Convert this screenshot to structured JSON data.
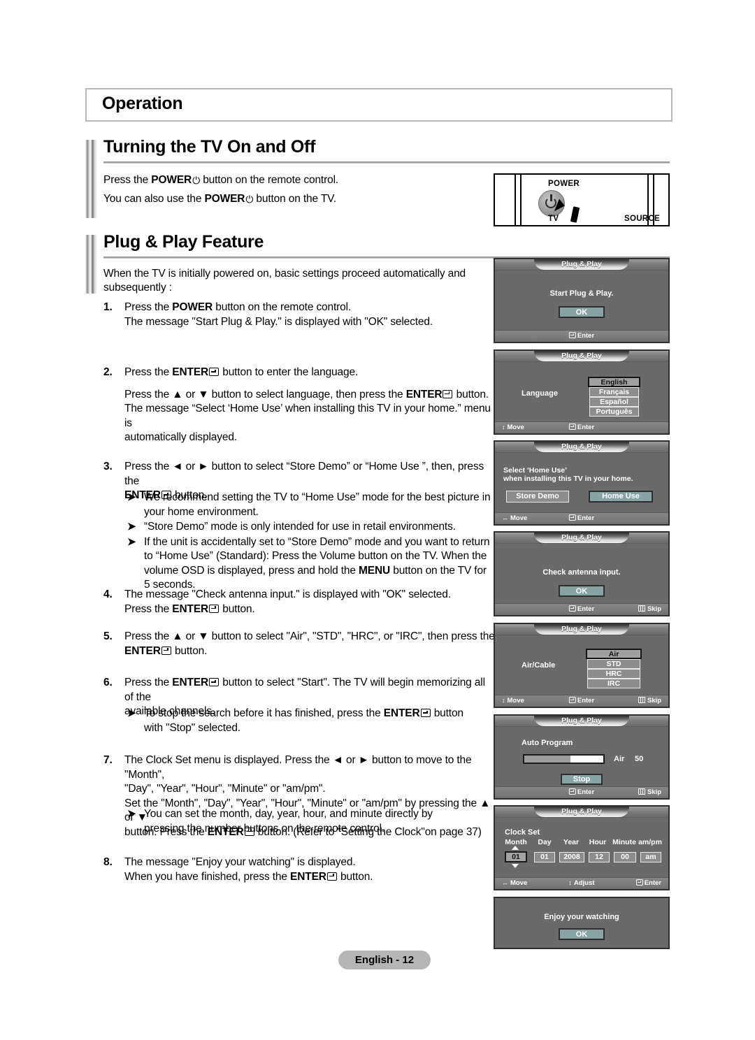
{
  "chapter": {
    "title": "Operation"
  },
  "sections": [
    {
      "heading": "Turning the TV On and Off"
    },
    {
      "heading": "Plug & Play Feature"
    }
  ],
  "turning_on": {
    "line1_pre": "Press the ",
    "line1_bold": "POWER",
    "line1_post": " button on the remote control.",
    "line2_pre": "You can also use the ",
    "line2_bold": "POWER",
    "line2_post": " button on the TV."
  },
  "tv_panel": {
    "power_label": "POWER",
    "tv_label": "TV",
    "source_label": "SOURCE"
  },
  "plug_intro": "When the TV is initially powered on, basic settings proceed automatically and subsequently :",
  "steps": [
    {
      "num": "1.",
      "lines": [
        "Press the POWER button on the remote control.",
        "The message \"Start Plug & Play.\" is displayed with \"OK\" selected."
      ]
    },
    {
      "num": "2.",
      "lines": [
        "Press the ENTER button to enter the language.",
        "Press the ▲ or ▼ button to select language, then press the ENTER button.",
        "The message “Select ‘Home Use’ when installing this TV in your home.” menu is",
        "automatically displayed."
      ]
    },
    {
      "num": "3.",
      "lines": [
        "Press the ◄ or ► button to select “Store Demo” or “Home Use ”, then, press the",
        "ENTER button."
      ],
      "bullets": [
        "We recommend setting the TV to “Home Use” mode for the best picture in your home environment.",
        "“Store Demo” mode is only intended for use in retail environments.",
        "If the unit is accidentally set to “Store Demo” mode and you want to return to “Home Use” (Standard): Press the Volume button on the TV. When the volume OSD is displayed, press and hold the MENU button on the TV for 5 seconds."
      ]
    },
    {
      "num": "4.",
      "lines": [
        "The message \"Check antenna input.\" is displayed with \"OK\" selected.",
        "Press the ENTER button."
      ]
    },
    {
      "num": "5.",
      "lines": [
        "Press the ▲ or ▼ button to select \"Air\", \"STD\", \"HRC\", or \"IRC\", then press the",
        "ENTER button."
      ]
    },
    {
      "num": "6.",
      "lines": [
        "Press the ENTER button to select \"Start\". The TV will begin memorizing all of the",
        "available channels."
      ],
      "bullets": [
        "To stop the search before it has finished, press the ENTER button with \"Stop\" selected."
      ]
    },
    {
      "num": "7.",
      "lines": [
        "The Clock Set menu is displayed. Press the ◄ or ► button to move to the \"Month\",",
        "\"Day\", \"Year\", \"Hour\", \"Minute\" or \"am/pm\".",
        "Set the \"Month\", \"Day\", \"Year\", \"Hour\", \"Minute\" or \"am/pm\" by pressing the ▲ or ▼",
        "button. Press the ENTER button. (Refer to \"Setting the Clock\"on page 37)"
      ],
      "bullets": [
        "You can set the month, day, year, hour, and minute directly by pressing the number buttons on the remote control."
      ]
    },
    {
      "num": "8.",
      "lines": [
        "The message \"Enjoy your watching\" is displayed.",
        "When you have finished, press the ENTER button."
      ]
    }
  ],
  "osd": {
    "title": "Plug & Play",
    "panel1": {
      "message": "Start Plug & Play.",
      "ok_label": "OK",
      "hints": [
        {
          "icon": "enter-icon",
          "label": "Enter"
        }
      ]
    },
    "panel2": {
      "left_label": "Language",
      "options": [
        "English",
        "Français",
        "Español",
        "Português"
      ],
      "selected": "English",
      "hints": [
        {
          "icon": "updown-icon",
          "label": "Move"
        },
        {
          "icon": "enter-icon",
          "label": "Enter"
        }
      ]
    },
    "panel3": {
      "message_line1": "Select ‘Home Use’",
      "message_line2": "when installing this TV in your home.",
      "btn_left": "Store Demo",
      "btn_right": "Home Use",
      "selected": "Home Use",
      "hints": [
        {
          "icon": "leftright-icon",
          "label": "Move"
        },
        {
          "icon": "enter-icon",
          "label": "Enter"
        }
      ]
    },
    "panel4": {
      "message": "Check antenna input.",
      "ok_label": "OK",
      "hints": [
        {
          "icon": "enter-icon",
          "label": "Enter"
        },
        {
          "icon": "skip-icon",
          "label": "Skip"
        }
      ]
    },
    "panel5": {
      "left_label": "Air/Cable",
      "options": [
        "Air",
        "STD",
        "HRC",
        "IRC"
      ],
      "selected": "Air",
      "hints": [
        {
          "icon": "updown-icon",
          "label": "Move"
        },
        {
          "icon": "enter-icon",
          "label": "Enter"
        },
        {
          "icon": "skip-icon",
          "label": "Skip"
        }
      ]
    },
    "panel6": {
      "title_label": "Auto Program",
      "progress_percent": 58,
      "band": "Air",
      "channel": "50",
      "stop_label": "Stop",
      "hints": [
        {
          "icon": "enter-icon",
          "label": "Enter"
        },
        {
          "icon": "skip-icon",
          "label": "Skip"
        }
      ]
    },
    "panel7": {
      "title_label": "Clock Set",
      "headers": [
        "Month",
        "Day",
        "Year",
        "Hour",
        "Minute",
        "am/pm"
      ],
      "values": [
        "01",
        "01",
        "2008",
        "12",
        "00",
        "am"
      ],
      "selected_index": 0,
      "hints": [
        {
          "icon": "leftright-icon",
          "label": "Move"
        },
        {
          "icon": "updown-icon",
          "label": "Adjust"
        },
        {
          "icon": "enter-icon",
          "label": "Enter"
        }
      ]
    },
    "panel8": {
      "message": "Enjoy your watching",
      "ok_label": "OK"
    }
  },
  "footer": {
    "page_label": "English - 12"
  },
  "colors": {
    "osd_body": "#6a6a6a",
    "osd_button_teal": "#87a3a3",
    "osd_option": "#8d8d8d",
    "footer_pill": "#b5b5b5"
  }
}
